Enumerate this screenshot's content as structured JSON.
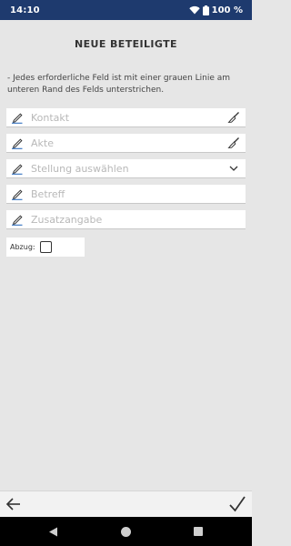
{
  "status_bar": {
    "time": "14:10",
    "battery": "100 %"
  },
  "page": {
    "title": "NEUE BETEILIGTE",
    "info": "- Jedes erforderliche Feld ist mit einer grauen Linie am unteren Rand des Felds unterstrichen."
  },
  "fields": [
    {
      "placeholder": "Kontakt",
      "trailing_icon": "broom-icon"
    },
    {
      "placeholder": "Akte",
      "trailing_icon": "broom-icon"
    },
    {
      "placeholder": "Stellung auswählen",
      "trailing_icon": "chevron-down-icon"
    },
    {
      "placeholder": "Betreff",
      "trailing_icon": ""
    },
    {
      "placeholder": "Zusatzangabe",
      "trailing_icon": ""
    }
  ],
  "abzug": {
    "label": "Abzug:",
    "checked": false
  },
  "colors": {
    "status_bar": "#1e3a6e",
    "accent_pen": "#2f6fbf",
    "background": "#e6e6e6"
  }
}
